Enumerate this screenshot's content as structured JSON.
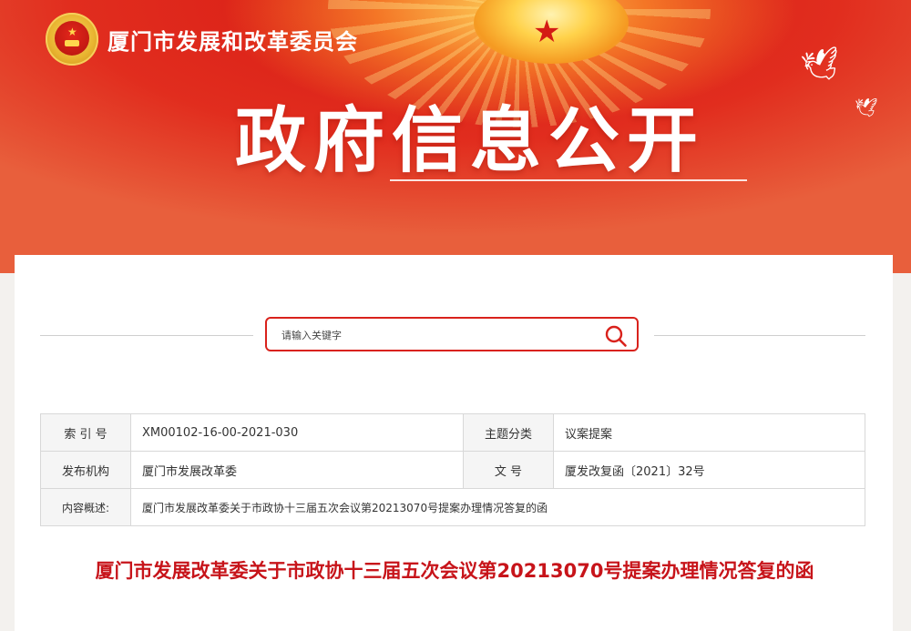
{
  "header": {
    "org_name": "厦门市发展和改革委员会",
    "banner_title": "政府信息公开"
  },
  "search": {
    "placeholder": "请输入关键字"
  },
  "meta_table": {
    "rows": [
      {
        "label_a": "索 引 号",
        "value_a": "XM00102-16-00-2021-030",
        "label_b": "主题分类",
        "value_b": "议案提案"
      },
      {
        "label_a": "发布机构",
        "value_a": "厦门市发展改革委",
        "label_b": "文 号",
        "value_b": "厦发改复函〔2021〕32号"
      }
    ],
    "summary_label": "内容概述:",
    "summary_value": "厦门市发展改革委关于市政协十三届五次会议第20213070号提案办理情况答复的函"
  },
  "document": {
    "title": "厦门市发展改革委关于市政协十三届五次会议第20213070号提案办理情况答复的函"
  },
  "colors": {
    "brand_red": "#d9221c",
    "title_red": "#c7141a"
  }
}
